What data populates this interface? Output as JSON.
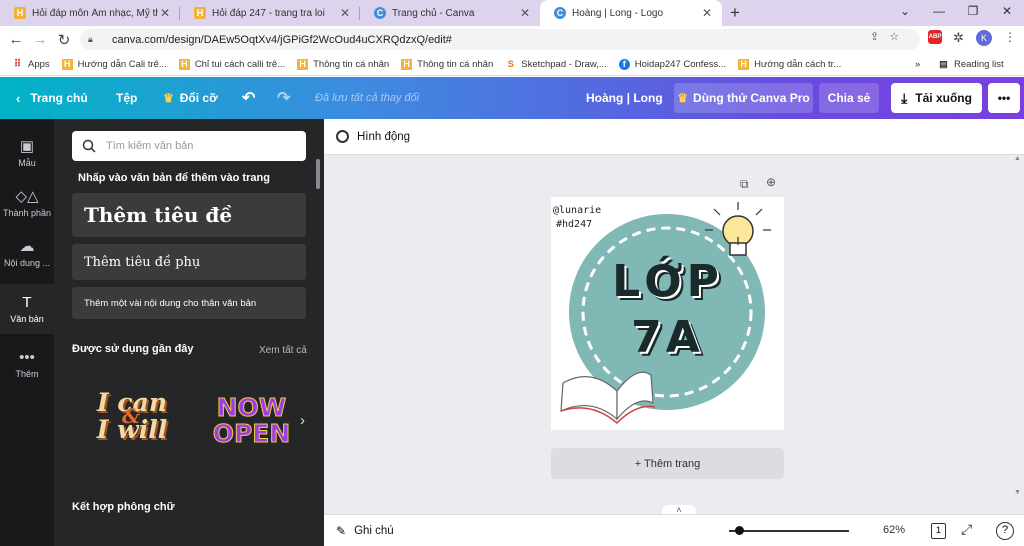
{
  "tabs": [
    {
      "title": "Hỏi đáp môn Âm nhạc, Mỹ thuật",
      "favicon": "hoidap-icon"
    },
    {
      "title": "Hỏi đáp 247 - trang tra loi",
      "favicon": "hoidap-icon"
    },
    {
      "title": "Trang chủ - Canva",
      "favicon": "canva-icon"
    },
    {
      "title": "Hoàng | Long - Logo",
      "favicon": "canva-icon"
    }
  ],
  "address": {
    "url": "canva.com/design/DAEw5OqtXv4/jGPiGf2WcOud4uCXRQdzxQ/edit#"
  },
  "profile_initial": "K",
  "bookmarks": {
    "apps": "Apps",
    "items": [
      "Hướng dẫn Cali trê...",
      "Chỉ tui cách calli trê...",
      "Thông tin cá nhân",
      "Thông tin cá nhân",
      "Sketchpad - Draw,...",
      "Hoidap247 Confess...",
      "Hướng dẫn cách tr..."
    ],
    "more": "»",
    "reading_list": "Reading list"
  },
  "canva_top": {
    "home": "Trang chủ",
    "file": "Tệp",
    "resize": "Đổi cỡ",
    "saved": "Đã lưu tất cả thay đổi",
    "design_name": "Hoàng | Long",
    "pro": "Dùng thử Canva Pro",
    "share": "Chia sẻ",
    "download": "Tải xuống",
    "more": "•••"
  },
  "rail": [
    {
      "label": "Mẫu",
      "icon": "template-icon"
    },
    {
      "label": "Thành phần",
      "icon": "elements-icon"
    },
    {
      "label": "Nội dung ...",
      "icon": "upload-icon"
    },
    {
      "label": "Văn bản",
      "icon": "text-icon"
    },
    {
      "label": "Thêm",
      "icon": "more-icon"
    }
  ],
  "panel": {
    "search_placeholder": "Tìm kiếm văn bản",
    "click_hint": "Nhấp vào văn bản để thêm vào trang",
    "heading": "Thêm tiêu đề",
    "subheading": "Thêm tiêu đề phụ",
    "body": "Thêm một vài nội dung cho thân văn bản",
    "recent": "Được sử dụng gần đây",
    "see_all": "Xem tất cả",
    "sample1_line1": "I can",
    "sample1_amp": "&",
    "sample1_line2": "I will",
    "sample2_line1": "NOW",
    "sample2_line2": "OPEN",
    "combos": "Kết hợp phông chữ"
  },
  "canvas": {
    "animate": "Hình động",
    "handle_line1": "@lunarie",
    "handle_line2": "#hd247",
    "logo_line1": "LỚP",
    "logo_line2": "7A",
    "add_page": "+ Thêm trang"
  },
  "bottom": {
    "notes": "Ghi chú",
    "zoom": "62%",
    "page_count": "1",
    "help": "?"
  },
  "colors": {
    "circle": "#7fb8b5",
    "accent": "#7d2ae8",
    "sample2": "#9b3fe0"
  }
}
